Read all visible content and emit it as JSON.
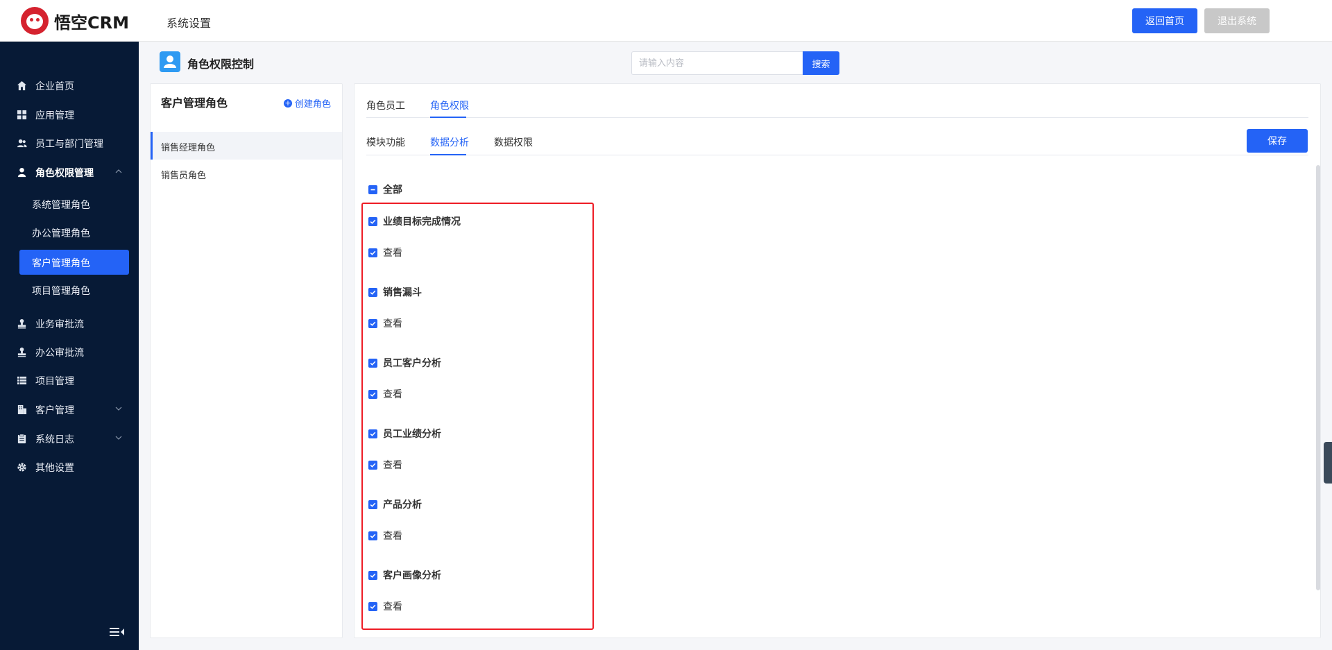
{
  "header": {
    "logo_text": "悟空CRM",
    "title": "系统设置",
    "home_button": "返回首页",
    "exit_button": "退出系统"
  },
  "sidebar": {
    "items": [
      {
        "label": "企业首页",
        "icon": "home-icon"
      },
      {
        "label": "应用管理",
        "icon": "grid-icon"
      },
      {
        "label": "员工与部门管理",
        "icon": "users-icon"
      },
      {
        "label": "角色权限管理",
        "icon": "user-icon",
        "expanded": true
      },
      {
        "label": "业务审批流",
        "icon": "stamp-icon"
      },
      {
        "label": "办公审批流",
        "icon": "stamp-icon"
      },
      {
        "label": "项目管理",
        "icon": "list-icon"
      },
      {
        "label": "客户管理",
        "icon": "building-icon"
      },
      {
        "label": "系统日志",
        "icon": "clipboard-icon"
      },
      {
        "label": "其他设置",
        "icon": "gear-icon"
      }
    ],
    "sub_items": [
      {
        "label": "系统管理角色",
        "active": false
      },
      {
        "label": "办公管理角色",
        "active": false
      },
      {
        "label": "客户管理角色",
        "active": true
      },
      {
        "label": "项目管理角色",
        "active": false
      }
    ]
  },
  "page": {
    "title": "角色权限控制",
    "search_placeholder": "请输入内容",
    "search_button": "搜索"
  },
  "roles_panel": {
    "title": "客户管理角色",
    "create_label": "创建角色",
    "roles": [
      {
        "label": "销售经理角色",
        "active": true
      },
      {
        "label": "销售员角色",
        "active": false
      }
    ]
  },
  "permissions": {
    "tabs": [
      {
        "label": "角色员工",
        "active": false
      },
      {
        "label": "角色权限",
        "active": true
      }
    ],
    "sub_tabs": [
      {
        "label": "模块功能",
        "active": false
      },
      {
        "label": "数据分析",
        "active": true
      },
      {
        "label": "数据权限",
        "active": false
      }
    ],
    "save_button": "保存",
    "all_label": "全部",
    "groups": [
      {
        "label": "业绩目标完成情况",
        "children": [
          "查看"
        ]
      },
      {
        "label": "销售漏斗",
        "children": [
          "查看"
        ]
      },
      {
        "label": "员工客户分析",
        "children": [
          "查看"
        ]
      },
      {
        "label": "员工业绩分析",
        "children": [
          "查看"
        ]
      },
      {
        "label": "产品分析",
        "children": [
          "查看"
        ]
      },
      {
        "label": "客户画像分析",
        "children": [
          "查看"
        ]
      }
    ]
  },
  "colors": {
    "primary": "#2463f6",
    "sidebar_bg": "#071a36",
    "highlight": "#ee1c25"
  }
}
